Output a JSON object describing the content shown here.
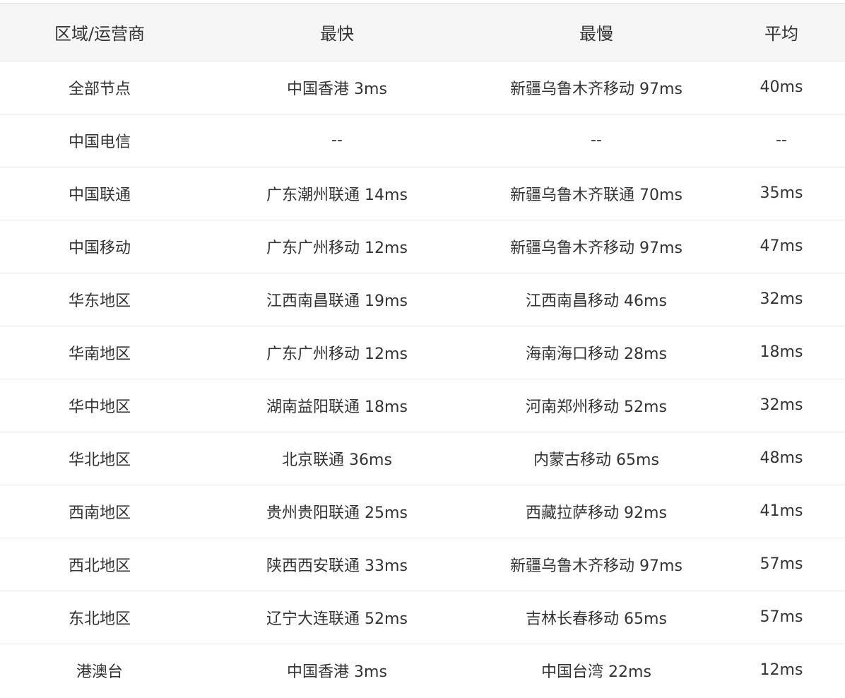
{
  "table": {
    "headers": [
      "区域/运营商",
      "最快",
      "最慢",
      "平均"
    ],
    "rows": [
      [
        "全部节点",
        "中国香港 3ms",
        "新疆乌鲁木齐移动 97ms",
        "40ms"
      ],
      [
        "中国电信",
        "--",
        "--",
        "--"
      ],
      [
        "中国联通",
        "广东潮州联通 14ms",
        "新疆乌鲁木齐联通 70ms",
        "35ms"
      ],
      [
        "中国移动",
        "广东广州移动 12ms",
        "新疆乌鲁木齐移动 97ms",
        "47ms"
      ],
      [
        "华东地区",
        "江西南昌联通 19ms",
        "江西南昌移动 46ms",
        "32ms"
      ],
      [
        "华南地区",
        "广东广州移动 12ms",
        "海南海口移动 28ms",
        "18ms"
      ],
      [
        "华中地区",
        "湖南益阳联通 18ms",
        "河南郑州移动 52ms",
        "32ms"
      ],
      [
        "华北地区",
        "北京联通 36ms",
        "内蒙古移动 65ms",
        "48ms"
      ],
      [
        "西南地区",
        "贵州贵阳联通 25ms",
        "西藏拉萨移动 92ms",
        "41ms"
      ],
      [
        "西北地区",
        "陕西西安联通 33ms",
        "新疆乌鲁木齐移动 97ms",
        "57ms"
      ],
      [
        "东北地区",
        "辽宁大连联通 52ms",
        "吉林长春移动 65ms",
        "57ms"
      ],
      [
        "港澳台",
        "中国香港 3ms",
        "中国台湾 22ms",
        "12ms"
      ]
    ]
  }
}
